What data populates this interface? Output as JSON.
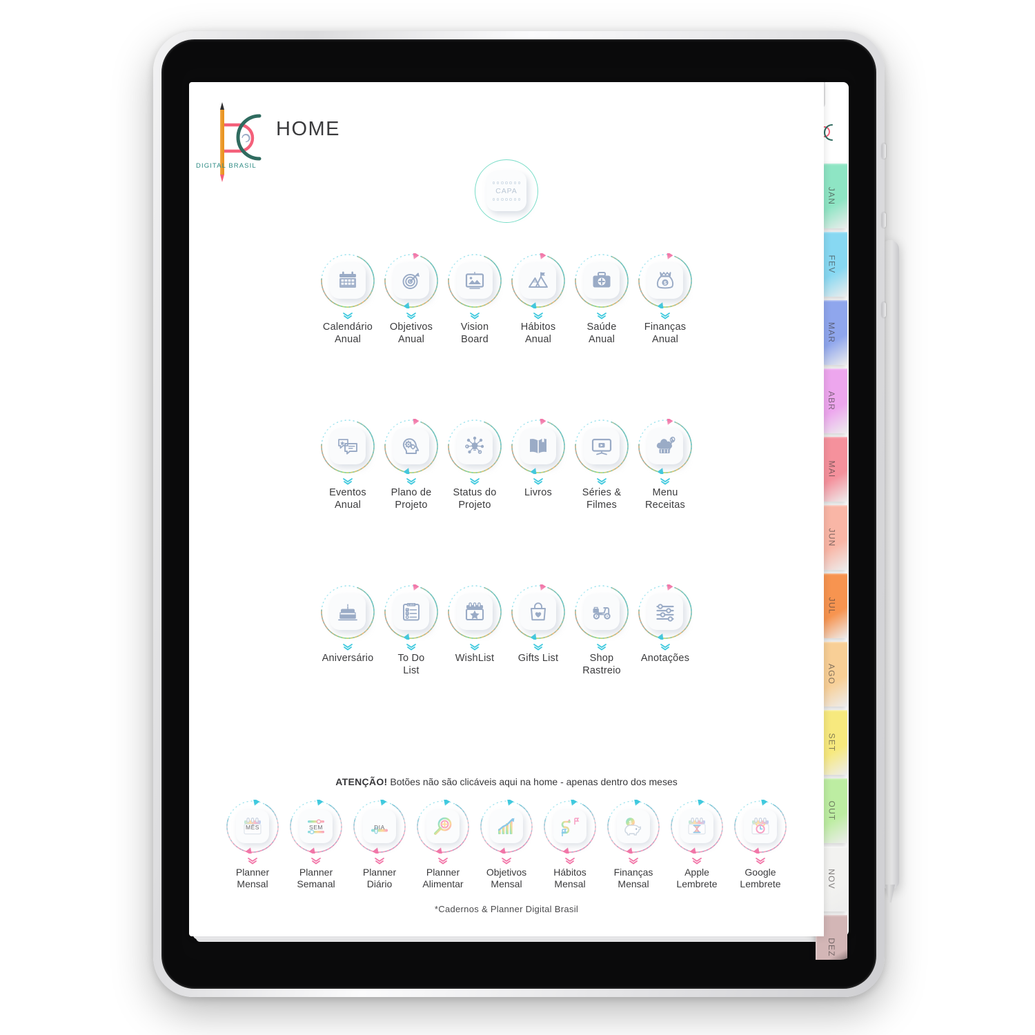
{
  "app": {
    "header_title": "HOME",
    "brand_name": "DIGITAL BRASIL",
    "footer": "*Cadernos & Planner Digital Brasil",
    "cover_button": "CAPA"
  },
  "colors": {
    "ring_teal": "#3fc9de",
    "ring_pink": "#f276a8",
    "ring_orange": "#f9b96a",
    "ring_green": "#a8d96a",
    "chevron_teal": "#3fc9de",
    "chevron_pink": "#f276a8",
    "brand_teal": "#2e8b84",
    "brand_pencil": "#f79b1f",
    "brand_pink": "#f4607a",
    "icon_blue_gray": "#9aabc6",
    "label_text": "#3b3b3d"
  },
  "notice": {
    "bold": "ATENÇÃO!",
    "rest": " Botões não são clicáveis aqui na home - apenas dentro dos meses"
  },
  "rows": [
    {
      "id": "annual-row-1",
      "items": [
        {
          "label": "Calendário\nAnual",
          "icon": "calendar-icon"
        },
        {
          "label": "Objetivos\nAnual",
          "icon": "target-icon"
        },
        {
          "label": "Vision\nBoard",
          "icon": "picture-frame-icon"
        },
        {
          "label": "Hábitos\nAnual",
          "icon": "mountain-flag-icon"
        },
        {
          "label": "Saúde\nAnual",
          "icon": "medical-kit-icon"
        },
        {
          "label": "Finanças\nAnual",
          "icon": "money-bag-icon"
        }
      ]
    },
    {
      "id": "annual-row-2",
      "items": [
        {
          "label": "Eventos\nAnual",
          "icon": "speech-bubbles-icon"
        },
        {
          "label": "Plano de\nProjeto",
          "icon": "head-gears-icon"
        },
        {
          "label": "Status do\nProjeto",
          "icon": "network-idea-icon"
        },
        {
          "label": "Livros",
          "icon": "open-book-icon"
        },
        {
          "label": "Séries &\nFilmes",
          "icon": "tv-play-icon"
        },
        {
          "label": "Menu\nReceitas",
          "icon": "chef-hat-icon"
        }
      ]
    },
    {
      "id": "annual-row-3",
      "items": [
        {
          "label": "Aniversário",
          "icon": "birthday-cake-icon"
        },
        {
          "label": "To Do\nList",
          "icon": "checklist-icon"
        },
        {
          "label": "WishList",
          "icon": "calendar-star-icon"
        },
        {
          "label": "Gifts List",
          "icon": "gift-bag-heart-icon"
        },
        {
          "label": "Shop\nRastreio",
          "icon": "scooter-delivery-icon"
        },
        {
          "label": "Anotações",
          "icon": "sliders-icon"
        }
      ]
    }
  ],
  "monthly_row": {
    "id": "monthly-row",
    "items": [
      {
        "label": "Planner\nMensal",
        "icon": "calendar-month-icon",
        "mini": "MÊS"
      },
      {
        "label": "Planner\nSemanal",
        "icon": "slider-week-icon",
        "mini": "SEM"
      },
      {
        "label": "Planner\nDiário",
        "icon": "slider-day-icon",
        "mini": "DIA"
      },
      {
        "label": "Planner\nAlimentar",
        "icon": "magnifier-food-icon",
        "mini": ""
      },
      {
        "label": "Objetivos\nMensal",
        "icon": "growth-chart-icon",
        "mini": ""
      },
      {
        "label": "Hábitos\nMensal",
        "icon": "path-journey-icon",
        "mini": ""
      },
      {
        "label": "Finanças\nMensal",
        "icon": "piggy-bank-icon",
        "mini": ""
      },
      {
        "label": "Apple\nLembrete",
        "icon": "calendar-hourglass-icon",
        "mini": ""
      },
      {
        "label": "Google\nLembrete",
        "icon": "calendar-clock-icon",
        "mini": ""
      }
    ]
  },
  "month_tabs": [
    {
      "label": "JAN",
      "color": "#8ee5c4"
    },
    {
      "label": "FEV",
      "color": "#87d8f2"
    },
    {
      "label": "MAR",
      "color": "#8fa6ed"
    },
    {
      "label": "ABR",
      "color": "#eda6ee"
    },
    {
      "label": "MAI",
      "color": "#f5919c"
    },
    {
      "label": "JUN",
      "color": "#f9b6a6"
    },
    {
      "label": "JUL",
      "color": "#f79450"
    },
    {
      "label": "AGO",
      "color": "#f8cf96"
    },
    {
      "label": "SET",
      "color": "#f7e97e"
    },
    {
      "label": "OUT",
      "color": "#bdeda2"
    },
    {
      "label": "NOV",
      "color": "#f2f2f0"
    },
    {
      "label": "DEZ",
      "color": "#d3b6b6"
    }
  ]
}
